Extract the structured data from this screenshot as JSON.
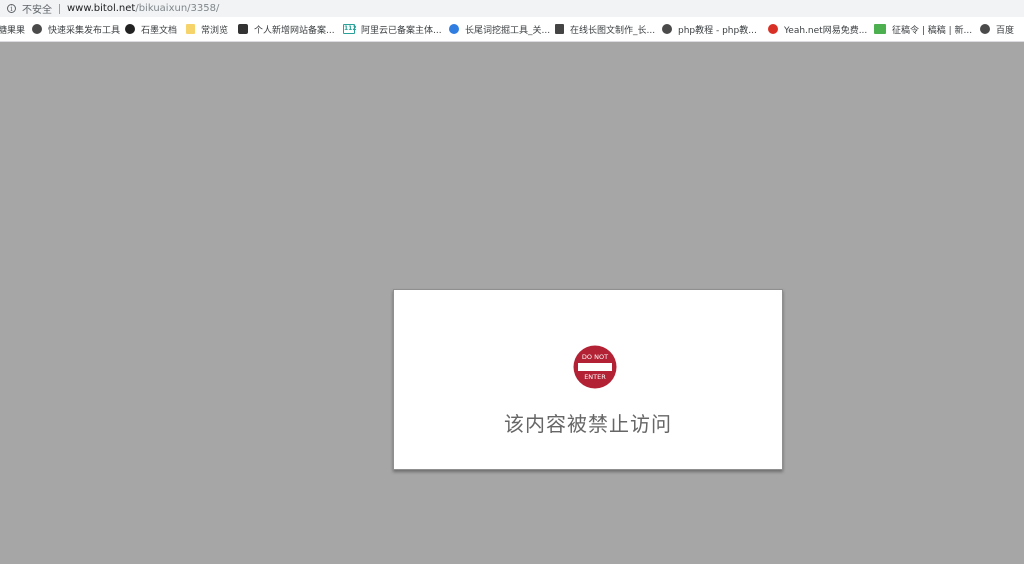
{
  "address_bar": {
    "security_text": "不安全",
    "url_host": "www.bitol.net",
    "url_path": "/bikuaixun/3358/"
  },
  "bookmarks": [
    {
      "label": "糖果果",
      "icon": "none"
    },
    {
      "label": "快速采集发布工具",
      "icon": "globe-icon"
    },
    {
      "label": "石墨文档",
      "icon": "shimo-icon"
    },
    {
      "label": "常浏览",
      "icon": "folder-icon"
    },
    {
      "label": "个人新增网站备案...",
      "icon": "site-icon"
    },
    {
      "label": "阿里云已备案主体...",
      "icon": "aliyun-112-icon"
    },
    {
      "label": "长尾词挖掘工具_关...",
      "icon": "blue-circle-icon"
    },
    {
      "label": "在线长图文制作_长...",
      "icon": "download-icon"
    },
    {
      "label": "php教程 - php教...",
      "icon": "globe-icon"
    },
    {
      "label": "Yeah.net网易免费...",
      "icon": "netease-icon"
    },
    {
      "label": "征稿令 | 稿稿 | 新...",
      "icon": "green-icon"
    },
    {
      "label": "百度",
      "icon": "globe-icon"
    }
  ],
  "dialog": {
    "sign_top_text": "DO NOT",
    "sign_bottom_text": "ENTER",
    "message": "该内容被禁止访问",
    "sign_color": "#b22234"
  }
}
